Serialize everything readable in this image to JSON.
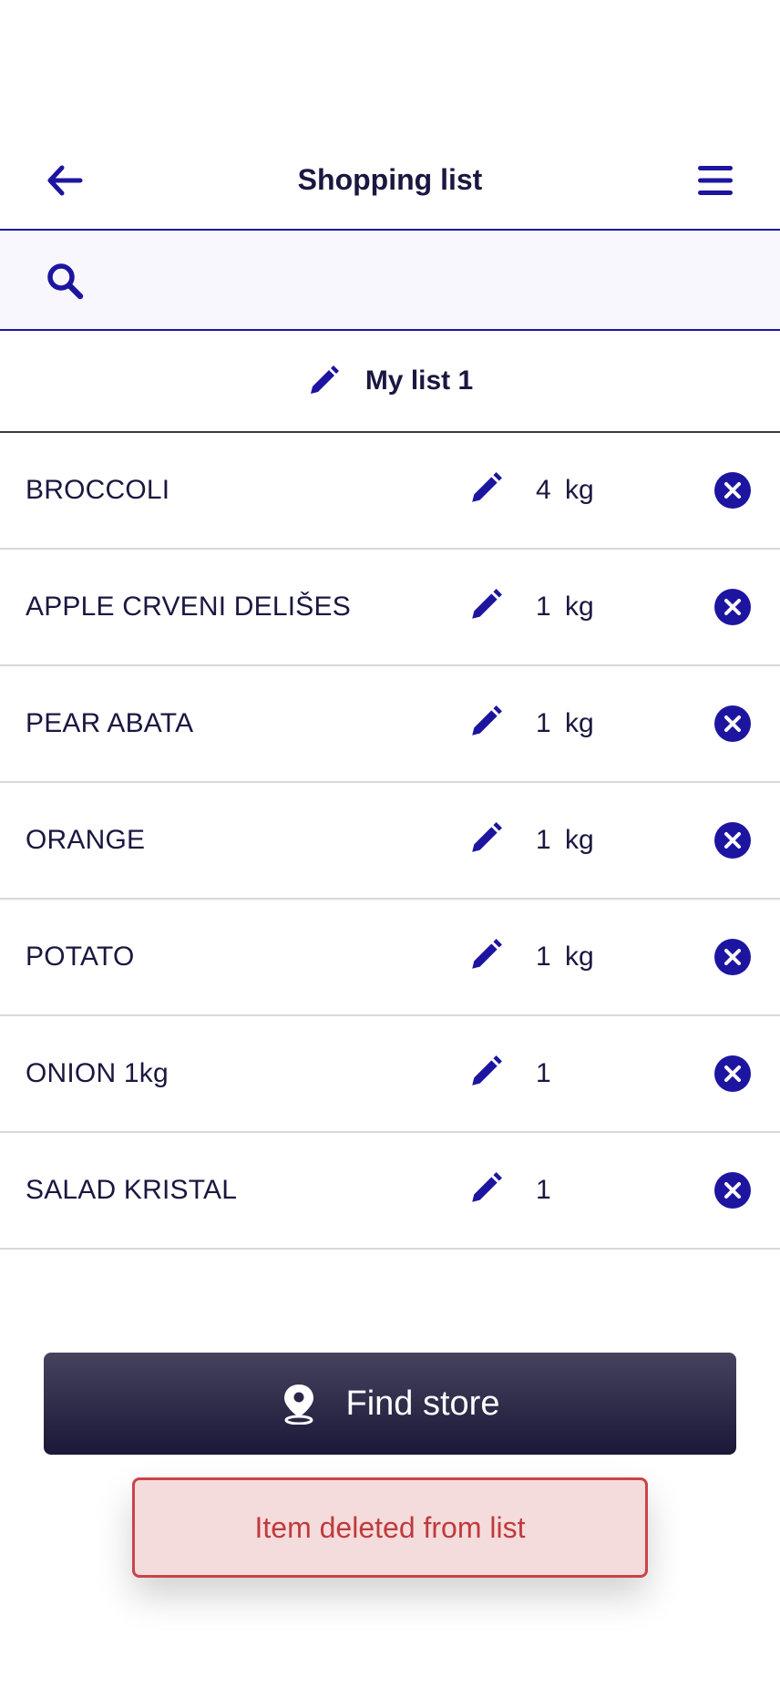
{
  "header": {
    "title": "Shopping list",
    "back_icon": "arrow-left-icon",
    "menu_icon": "hamburger-menu-icon"
  },
  "search": {
    "icon": "search-icon",
    "placeholder": "",
    "value": ""
  },
  "list": {
    "name": "My list 1",
    "edit_icon": "pencil-icon"
  },
  "items": [
    {
      "name": "BROCCOLI",
      "qty": "4",
      "unit": "kg"
    },
    {
      "name": "APPLE CRVENI DELIŠES",
      "qty": "1",
      "unit": "kg"
    },
    {
      "name": "PEAR ABATA",
      "qty": "1",
      "unit": "kg"
    },
    {
      "name": "ORANGE",
      "qty": "1",
      "unit": "kg"
    },
    {
      "name": "POTATO",
      "qty": "1",
      "unit": "kg"
    },
    {
      "name": "ONION 1kg",
      "qty": "1",
      "unit": ""
    },
    {
      "name": "SALAD KRISTAL",
      "qty": "1",
      "unit": ""
    }
  ],
  "find_store": {
    "label": "Find store",
    "icon": "location-pin-icon"
  },
  "toast": {
    "message": "Item deleted from list"
  },
  "colors": {
    "accent": "#1d15a0",
    "text": "#1b1740",
    "button_bg_top": "#46435e",
    "button_bg_bottom": "#1b1738",
    "toast_bg": "#f5dcdc",
    "toast_border": "#c94447",
    "toast_text": "#c03a3d",
    "search_bg": "#f8f7fd"
  }
}
